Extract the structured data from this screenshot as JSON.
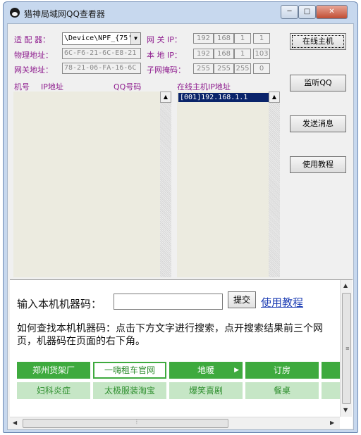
{
  "window": {
    "title": "猎神局域网QQ查看器",
    "controls": {
      "minimize": "─",
      "maximize": "□",
      "close": "✕"
    }
  },
  "form": {
    "adapter_label": "适 配 器：",
    "adapter_value": "\\Device\\NPF_{75'",
    "mac_label": "物理地址：",
    "mac_value": "6C-F6-21-6C-E8-21",
    "gateway_mac_label": "网关地址：",
    "gateway_mac_value": "78-21-06-FA-16-6C",
    "gateway_ip_label": "网 关 IP：",
    "gateway_ip": [
      "192",
      "168",
      "1",
      "1"
    ],
    "local_ip_label": "本 地 IP：",
    "local_ip": [
      "192",
      "168",
      "1",
      "103"
    ],
    "subnet_label": "子网掩码：",
    "subnet": [
      "255",
      "255",
      "255",
      "0"
    ]
  },
  "buttons": {
    "online_hosts": "在线主机",
    "listen_qq": "监听QQ",
    "send_message": "发送消息",
    "tutorial": "使用教程"
  },
  "list_headers": {
    "machine_no": "机号",
    "ip_address": "IP地址",
    "qq_number": "QQ号码",
    "online_host_ip": "在线主机IP地址"
  },
  "online_hosts": [
    "[001]192.168.1.1"
  ],
  "web": {
    "machine_code_label": "输入本机机器码：",
    "machine_code_value": "",
    "submit_label": "提交",
    "help_link": "使用教程",
    "instructions": "如何查找本机机器码：点击下方文字进行搜索，点开搜索结果前三个网页，机器码在页面的右下角。",
    "tiles_row1": [
      "郑州货架厂",
      "一嗨租车官网",
      "地暖",
      "订房"
    ],
    "tiles_row2": [
      "妇科炎症",
      "太极服装淘宝",
      "爆笑喜剧",
      "餐桌"
    ]
  },
  "colors": {
    "label_purple": "#8e1c8e",
    "tile_green": "#3eaa3e",
    "selection_blue": "#0a246a",
    "link_blue": "#1a3bb3"
  }
}
